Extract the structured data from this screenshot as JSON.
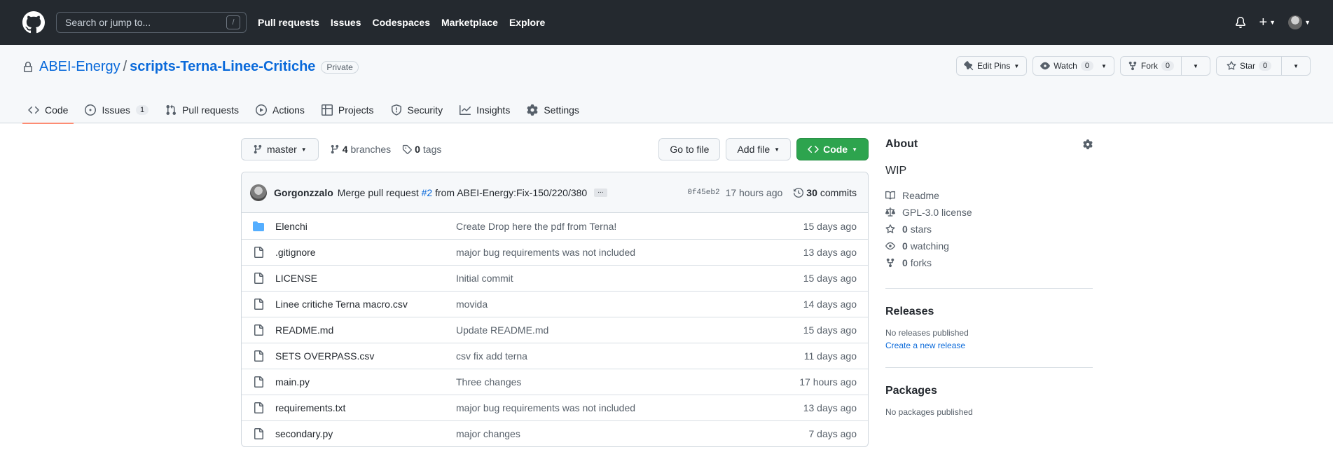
{
  "header": {
    "search_placeholder": "Search or jump to...",
    "search_shortcut": "/",
    "nav": [
      "Pull requests",
      "Issues",
      "Codespaces",
      "Marketplace",
      "Explore"
    ],
    "plus_label": "+"
  },
  "repo": {
    "owner": "ABEI-Energy",
    "separator": "/",
    "name": "scripts-Terna-Linee-Critiche",
    "visibility": "Private",
    "actions": {
      "edit_pins": "Edit Pins",
      "watch": "Watch",
      "watch_count": "0",
      "fork": "Fork",
      "fork_count": "0",
      "star": "Star",
      "star_count": "0"
    },
    "tabs": [
      {
        "label": "Code",
        "icon": "code-icon"
      },
      {
        "label": "Issues",
        "icon": "issue-icon",
        "count": "1"
      },
      {
        "label": "Pull requests",
        "icon": "pull-request-icon"
      },
      {
        "label": "Actions",
        "icon": "play-icon"
      },
      {
        "label": "Projects",
        "icon": "table-icon"
      },
      {
        "label": "Security",
        "icon": "shield-icon"
      },
      {
        "label": "Insights",
        "icon": "graph-icon"
      },
      {
        "label": "Settings",
        "icon": "gear-icon"
      }
    ]
  },
  "toolbar": {
    "branch": "master",
    "branches_count": "4",
    "branches_label": "branches",
    "tags_count": "0",
    "tags_label": "tags",
    "go_to_file": "Go to file",
    "add_file": "Add file",
    "code": "Code"
  },
  "commit": {
    "author": "Gorgonzzalo",
    "message_prefix": "Merge pull request",
    "pr_link": "#2",
    "message_suffix": "from ABEI-Energy:Fix-150/220/380",
    "ellipsis": "...",
    "sha": "0f45eb2",
    "ago": "17 hours ago",
    "commits_count": "30",
    "commits_label": "commits"
  },
  "files": [
    {
      "name": "Elenchi",
      "type": "dir",
      "message": "Create Drop here the pdf from Terna!",
      "age": "15 days ago"
    },
    {
      "name": ".gitignore",
      "type": "file",
      "message": "major bug requirements was not included",
      "age": "13 days ago"
    },
    {
      "name": "LICENSE",
      "type": "file",
      "message": "Initial commit",
      "age": "15 days ago"
    },
    {
      "name": "Linee critiche Terna macro.csv",
      "type": "file",
      "message": "movida",
      "age": "14 days ago"
    },
    {
      "name": "README.md",
      "type": "file",
      "message": "Update README.md",
      "age": "15 days ago"
    },
    {
      "name": "SETS OVERPASS.csv",
      "type": "file",
      "message": "csv fix add terna",
      "age": "11 days ago"
    },
    {
      "name": "main.py",
      "type": "file",
      "message": "Three changes",
      "age": "17 hours ago"
    },
    {
      "name": "requirements.txt",
      "type": "file",
      "message": "major bug requirements was not included",
      "age": "13 days ago"
    },
    {
      "name": "secondary.py",
      "type": "file",
      "message": "major changes",
      "age": "7 days ago"
    }
  ],
  "about": {
    "title": "About",
    "description": "WIP",
    "readme": "Readme",
    "license": "GPL-3.0 license",
    "stars_count": "0",
    "stars_label": "stars",
    "watching_count": "0",
    "watching_label": "watching",
    "forks_count": "0",
    "forks_label": "forks"
  },
  "releases": {
    "title": "Releases",
    "none": "No releases published",
    "create_link": "Create a new release"
  },
  "packages": {
    "title": "Packages",
    "none": "No packages published"
  },
  "colors": {
    "header_bg": "#24292f",
    "link": "#0969da",
    "green": "#2da44e",
    "active_tab": "#fd8c73"
  }
}
